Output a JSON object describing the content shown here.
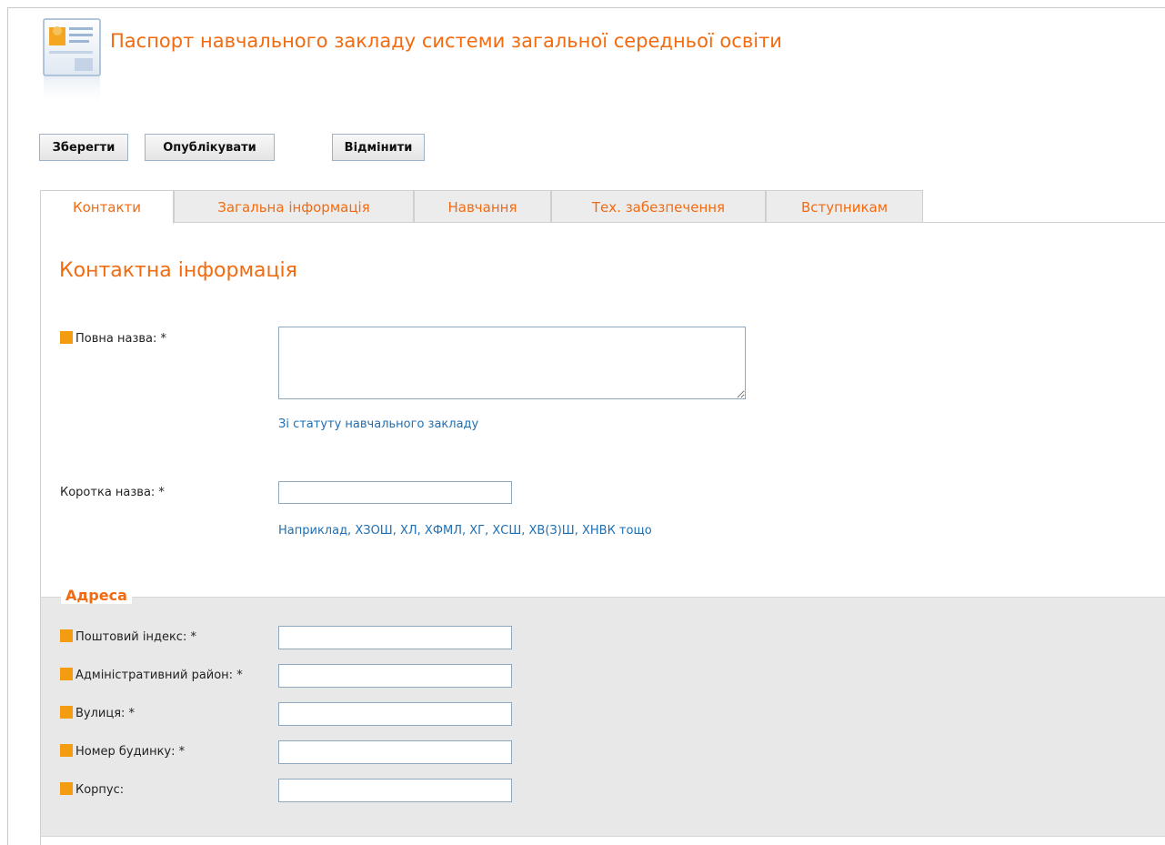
{
  "page": {
    "title": "Паспорт навчального закладу системи загальної середньої освіти",
    "icon": "profile-card-icon"
  },
  "toolbar": {
    "save_label": "Зберегти",
    "publish_label": "Опублікувати",
    "cancel_label": "Відмінити"
  },
  "tabs": [
    {
      "label": "Контакти",
      "active": true
    },
    {
      "label": "Загальна інформація",
      "active": false
    },
    {
      "label": "Навчання",
      "active": false
    },
    {
      "label": "Тех. забезпечення",
      "active": false
    },
    {
      "label": "Вступникам",
      "active": false
    }
  ],
  "section": {
    "title": "Контактна інформація"
  },
  "fields": {
    "full_name": {
      "label": "Повна назва: *",
      "value": "",
      "hint": "Зі статуту навчального закладу"
    },
    "short_name": {
      "label": "Коротка назва: *",
      "value": "",
      "hint": "Наприклад, ХЗОШ, ХЛ, ХФМЛ, ХГ, ХСШ, ХВ(З)Ш, ХНВК тощо"
    }
  },
  "address": {
    "legend": "Адреса",
    "postal_code": {
      "label": "Поштовий індекс: *",
      "value": ""
    },
    "district": {
      "label": "Адміністративний район: *",
      "value": ""
    },
    "street": {
      "label": "Вулиця: *",
      "value": ""
    },
    "house_number": {
      "label": "Номер будинку: *",
      "value": ""
    },
    "building": {
      "label": "Корпус:",
      "value": ""
    }
  },
  "colors": {
    "accent": "#f26b10",
    "marker": "#f39c12",
    "hint_link": "#1e6fb3",
    "address_bg": "#e8e8e8"
  }
}
